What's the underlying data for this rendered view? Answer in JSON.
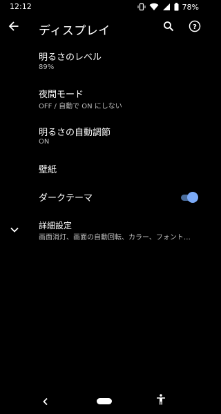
{
  "status_bar": {
    "time": "12:12",
    "battery_percent": "78%",
    "icons": [
      "vibrate-icon",
      "wifi-icon",
      "signal-icon",
      "battery-icon"
    ]
  },
  "app_bar": {
    "title": "ディスプレイ",
    "icons": [
      "back-arrow-icon",
      "search-icon",
      "help-icon"
    ]
  },
  "settings": {
    "brightness": {
      "title": "明るさのレベル",
      "summary": "89%"
    },
    "night_light": {
      "title": "夜間モード",
      "summary": "OFF / 自動で ON にしない"
    },
    "adaptive_brightness": {
      "title": "明るさの自動調節",
      "summary": "ON"
    },
    "wallpaper": {
      "title": "壁紙"
    },
    "dark_theme": {
      "title": "ダークテーマ",
      "enabled": true
    },
    "advanced": {
      "title": "詳細設定",
      "summary": "画面消灯、画面の自動回転、カラー、フォント…",
      "icon": "chevron-down-icon"
    }
  },
  "nav_bar": {
    "icons": [
      "nav-back-icon",
      "nav-home-pill",
      "accessibility-icon"
    ]
  },
  "colors": {
    "background": "#000000",
    "text_primary": "#ffffff",
    "text_secondary": "#bdbdbd",
    "toggle_thumb": "#7baaf7",
    "toggle_track": "#4a6d9c"
  }
}
